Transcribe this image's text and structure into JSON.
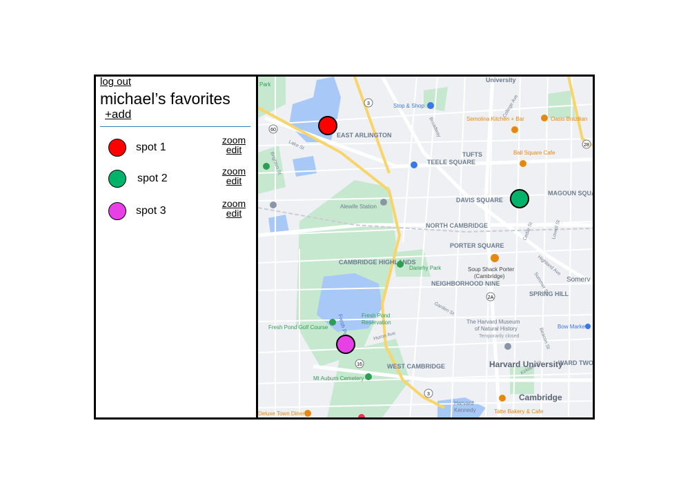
{
  "sidebar": {
    "logout": "log out",
    "title": "michael’s favorites",
    "add": "+add",
    "zoom_label": "zoom",
    "edit_label": "edit",
    "spots": [
      {
        "label": "spot 1",
        "color": "#ff0000"
      },
      {
        "label": "spot 2",
        "color": "#00b36b"
      },
      {
        "label": "spot 3",
        "color": "#e640e6"
      }
    ]
  },
  "map": {
    "places": {
      "east_arlington": "EAST ARLINGTON",
      "teele_square": "TEELE SQUARE",
      "tufts": "TUFTS",
      "davis_square": "DAVIS SQUARE",
      "magoun_square": "MAGOUN SQUARE",
      "north_cambridge": "NORTH CAMBRIDGE",
      "porter_square": "PORTER SQUARE",
      "cambridge_highlands": "CAMBRIDGE HIGHLANDS",
      "neighborhood_nine": "NEIGHBORHOOD NINE",
      "spring_hill": "SPRING HILL",
      "west_cambridge": "WEST CAMBRIDGE",
      "harvard_university": "Harvard University",
      "cambridge": "Cambridge",
      "ward_two": "WARD TWO",
      "somerville": "Somerv",
      "university": "University"
    },
    "pois": {
      "stop_shop": "Stop & Shop",
      "semolina": "Semolina Kitchen + Bar",
      "oasis": "Oasis Brazilian",
      "ball_square": "Ball Square Cafe",
      "alewife": "Alewife Station",
      "danehy": "Danehy Park",
      "soup_shack": "Soup Shack Porter",
      "soup_shack_sub": "(Cambridge)",
      "fresh_pond": "Fresh Pond",
      "fresh_pond_res": "Fresh Pond",
      "fresh_pond_res2": "Reservation",
      "golf": "Fresh Pond Golf Course",
      "mt_auburn": "Mt Auburn Cemetery",
      "museum1": "The Harvard Museum",
      "museum2": "of Natural History",
      "museum3": "Temporarily closed",
      "bow_market": "Bow Market",
      "tatte": "Tatte Bakery & Cafe",
      "harvard_kennedy": "Harvard",
      "harvard_kennedy2": "Kennedy",
      "deluxe": "Deluxe Town Diner",
      "park": "Park"
    },
    "streets": {
      "broadway": "Broadway",
      "college_ave": "College Ave",
      "lake_st": "Lake St",
      "brighton_st": "Brighton St",
      "huron_ave": "Huron Ave",
      "highland_ave": "Highland Ave",
      "garden_st": "Garden St",
      "kirkland_st": "Kirkland St",
      "beacon_st": "Beacon St",
      "cedar_st": "Cedar St",
      "lowell_st": "Lowell St",
      "summer_st": "Summer St"
    },
    "route_labels": {
      "r3a": "3",
      "r3b": "3",
      "r60": "60",
      "r16": "16",
      "r2a": "2A",
      "r28": "28"
    },
    "markers": [
      {
        "spot": "spot 1",
        "color": "#ff0000"
      },
      {
        "spot": "spot 2",
        "color": "#00b36b"
      },
      {
        "spot": "spot 3",
        "color": "#e640e6"
      }
    ],
    "colors": {
      "water": "#a8c8f8",
      "park": "#c5e8cf",
      "highway": "#f7d56a",
      "label": "#6b7b8e",
      "poi_orange": "#e8870e",
      "poi_blue": "#3b78e7",
      "poi_green": "#2e9e57"
    }
  }
}
